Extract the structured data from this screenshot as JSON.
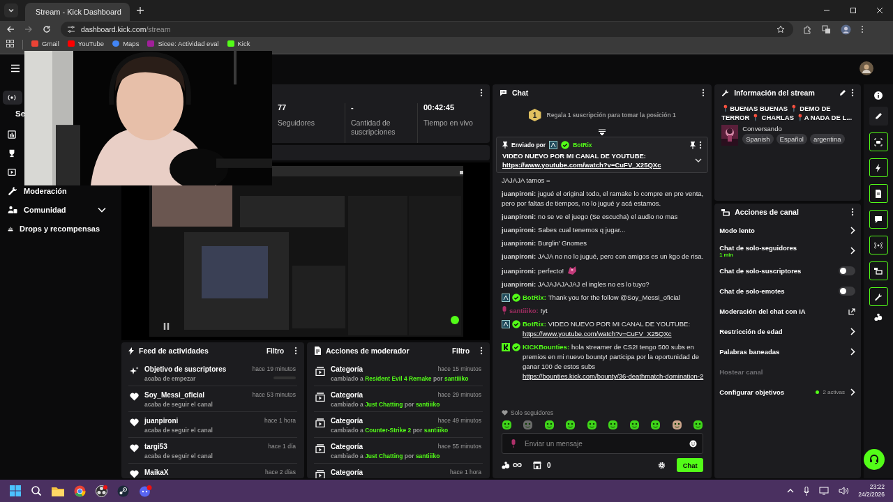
{
  "browser": {
    "tab_title": "Stream - Kick Dashboard",
    "url_host": "dashboard.kick.com",
    "url_path": "/stream",
    "bookmarks": [
      "Gmail",
      "YouTube",
      "Maps",
      "Sicee: Actividad eval",
      "Kick"
    ]
  },
  "sidebar": {
    "section": "Se",
    "items": [
      {
        "selected": true,
        "expandable": false
      },
      {
        "selected": false,
        "expandable": false
      },
      {
        "selected": false,
        "expandable": false
      },
      {
        "selected": false,
        "expandable": false
      },
      {
        "label": "Moderación",
        "selected": false,
        "expandable": false
      },
      {
        "label": "Comunidad",
        "selected": false,
        "expandable": true
      },
      {
        "label": "Drops y recompensas",
        "selected": false,
        "expandable": false
      }
    ]
  },
  "stats": [
    {
      "value": "77",
      "label": "Seguidores"
    },
    {
      "value": "-",
      "label": "Cantidad de suscripciones"
    },
    {
      "value": "00:42:45",
      "label": "Tiempo en vivo"
    }
  ],
  "activity_feed": {
    "title": "Feed de actividades",
    "filter": "Filtro",
    "items": [
      {
        "kind": "goal",
        "title": "Objetivo de suscriptores",
        "sub": "acaba de empezar",
        "time": "hace 19 minutos",
        "level": 0
      },
      {
        "kind": "follow",
        "title": "Soy_Messi_oficial",
        "sub": "acaba de seguir el canal",
        "time": "hace 53 minutos"
      },
      {
        "kind": "follow",
        "title": "juanpironi",
        "sub": "acaba de seguir el canal",
        "time": "hace 1 hora"
      },
      {
        "kind": "follow",
        "title": "targi53",
        "sub": "acaba de seguir el canal",
        "time": "hace 1 día"
      },
      {
        "kind": "follow",
        "title": "MaikaX",
        "time": "hace 2 días"
      }
    ]
  },
  "moderator_actions": {
    "title": "Acciones de moderador",
    "filter": "Filtro",
    "items": [
      {
        "title": "Categoría",
        "time": "hace 15 minutos",
        "prefix": "cambiado a",
        "target": "Resident Evil 4 Remake",
        "by": "por",
        "user": "santiiiko"
      },
      {
        "title": "Categoría",
        "time": "hace 29 minutos",
        "prefix": "cambiado a",
        "target": "Just Chatting",
        "by": "por",
        "user": "santiiiko"
      },
      {
        "title": "Categoría",
        "time": "hace 49 minutos",
        "prefix": "cambiado a",
        "target": "Counter-Strike 2",
        "by": "por",
        "user": "santiiiko"
      },
      {
        "title": "Categoría",
        "time": "hace 55 minutos",
        "prefix": "cambiado a",
        "target": "Just Chatting",
        "by": "por",
        "user": "santiiiko"
      },
      {
        "title": "Categoría",
        "time": "hace 1 hora"
      }
    ]
  },
  "chat": {
    "title": "Chat",
    "separator": ":",
    "promo_badge": "1",
    "promo": "Regala 1 suscripción para tomar la posición 1",
    "pinned": {
      "prefix": "Enviado por",
      "sender": "BotRix",
      "text": "VIDEO NUEVO POR MI CANAL DE YOUTUBE:",
      "link": "https://www.youtube.com/watch?v=CuFV_X25QXc"
    },
    "messages": [
      {
        "kind": "plain",
        "text": "JAJAJA tamos ="
      },
      {
        "kind": "user",
        "user": "juanpironi",
        "color": "#d4d4d4",
        "text": "jugué el original todo, el ramake lo compre en pre venta, pero por faltas de tiempos, no lo jugué y acá estamos."
      },
      {
        "kind": "user",
        "user": "juanpironi",
        "color": "#d4d4d4",
        "text": "no se ve el juego (Se escucha) el audio no mas"
      },
      {
        "kind": "user",
        "user": "juanpironi",
        "color": "#d4d4d4",
        "text": "Sabes cual tenemos q jugar..."
      },
      {
        "kind": "user",
        "user": "juanpironi",
        "color": "#d4d4d4",
        "text": "Burglin' Gnomes"
      },
      {
        "kind": "user",
        "user": "juanpironi",
        "color": "#d4d4d4",
        "text": "JAJA no no lo jugué, pero con amigos es un kgo de risa."
      },
      {
        "kind": "user",
        "user": "juanpironi",
        "color": "#d4d4d4",
        "text": "perfecto!",
        "emote": true
      },
      {
        "kind": "user",
        "user": "juanpironi",
        "color": "#d4d4d4",
        "text": "JAJAJAJAJAJ el ingles no es lo tuyo?"
      },
      {
        "kind": "bot",
        "user": "BotRix",
        "color": "#53fc18",
        "text": "Thank you for the follow @Soy_Messi_oficial"
      },
      {
        "kind": "mic",
        "user": "santiiiko",
        "color": "#9b2d5f",
        "text": "!yt"
      },
      {
        "kind": "bot",
        "user": "BotRix",
        "color": "#53fc18",
        "text": "VIDEO NUEVO POR MI CANAL DE YOUTUBE:",
        "link": "https://www.youtube.com/watch?v=CuFV_X25QXc"
      },
      {
        "kind": "kick",
        "user": "KICKBounties",
        "color": "#53fc18",
        "text": "hola streamer de CS2! tengo 500 subs en premios en mi nuevo bounty! participa por la oportunidad de ganar 100 de estos subs",
        "link": "https://bounties.kick.com/bounty/36-deathmatch-domination-2"
      }
    ],
    "mode_note": "Solo seguidores",
    "placeholder": "Enviar un mensaje",
    "points": "0",
    "send": "Chat"
  },
  "stream_info": {
    "title": "Información del stream",
    "stream_title": "📍BUENAS BUENAS 📍 DEMO DE TERROR 📍 CHARLAS 📍A NADA DE L...",
    "category": "Conversando",
    "tags": [
      "Spanish",
      "Español",
      "argentina"
    ]
  },
  "channel_actions": {
    "title": "Acciones de canal",
    "items": [
      {
        "kind": "link",
        "label": "Modo lento",
        "disabled": false
      },
      {
        "kind": "link",
        "label": "Chat de solo-seguidores",
        "sub": "1 min",
        "disabled": false
      },
      {
        "kind": "toggle",
        "label": "Chat de solo-suscriptores",
        "on": false,
        "disabled": false
      },
      {
        "kind": "toggle",
        "label": "Chat de solo-emotes",
        "on": false,
        "disabled": false
      },
      {
        "kind": "external",
        "label": "Moderación del chat con IA",
        "disabled": false
      },
      {
        "kind": "link",
        "label": "Restricción de edad",
        "disabled": false
      },
      {
        "kind": "link",
        "label": "Palabras baneadas",
        "disabled": false
      },
      {
        "kind": "none",
        "label": "Hostear canal",
        "disabled": true
      },
      {
        "kind": "link",
        "label": "Configurar objetivos",
        "status": "2 activas",
        "disabled": false
      }
    ]
  },
  "taskbar": {
    "time": "23:22",
    "date": "24/2/2026"
  }
}
